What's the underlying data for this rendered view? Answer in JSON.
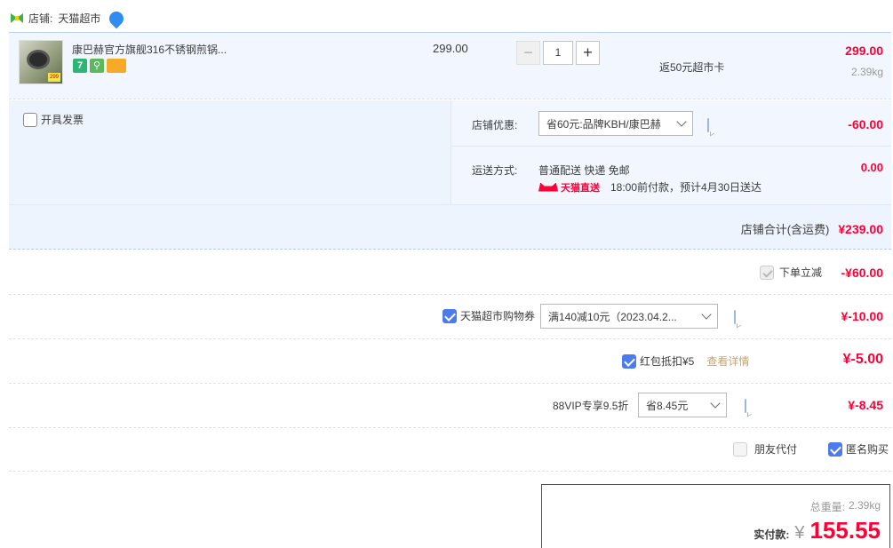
{
  "store": {
    "label": "店铺:",
    "name": "天猫超市",
    "icons": [
      "bowtie-store-icon",
      "drop-tag-icon"
    ]
  },
  "item": {
    "title": "康巴赫官方旗舰316不锈钢煎锅...",
    "thumb_badge": "299",
    "price": "299.00",
    "quantity": "1",
    "minus_label": "−",
    "plus_label": "+",
    "rebate": "返50元超市卡",
    "subtotal": "299.00",
    "weight": "2.39kg",
    "service_icons": [
      "7",
      "⚲",
      ""
    ]
  },
  "invoice": {
    "label": "开具发票"
  },
  "store_discount": {
    "label": "店铺优惠:",
    "selected": "省60元:品牌KBH/康巴赫",
    "amount": "-60.00"
  },
  "shipping": {
    "label": "运送方式:",
    "method": "普通配送 快递 免邮",
    "direct_label": "天猫直送",
    "eta": "18:00前付款，预计4月30日送达",
    "amount": "0.00"
  },
  "store_total": {
    "label": "店铺合计(含运费)",
    "amount": "¥239.00"
  },
  "summary": {
    "instant_discount": {
      "label": "下单立减",
      "amount": "-¥60.00"
    },
    "coupon": {
      "label": "天猫超市购物券",
      "selected": "满140减10元（2023.04.2...",
      "amount": "¥-10.00"
    },
    "red_packet": {
      "label": "红包抵扣¥5",
      "link": "查看详情",
      "amount": "¥-5.00"
    },
    "vip": {
      "label": "88VIP专享9.5折",
      "selected": "省8.45元",
      "amount": "¥-8.45"
    },
    "friend_pay": "朋友代付",
    "anonymous": "匿名购买"
  },
  "total": {
    "weight_label": "总重量:",
    "weight": "2.39kg",
    "pay_label": "实付款:",
    "currency": "¥",
    "amount": "155.55"
  }
}
